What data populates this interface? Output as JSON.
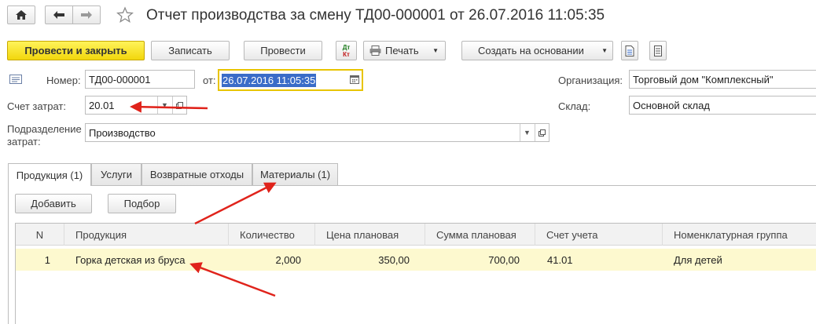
{
  "window": {
    "title": "Отчет производства за смену ТД00-000001 от 26.07.2016 11:05:35"
  },
  "nav": {
    "home_icon": "home-icon",
    "back_icon": "arrow-left-icon",
    "forward_icon": "arrow-right-icon",
    "favorite_icon": "star-icon"
  },
  "toolbar": {
    "post_close": "Провести и закрыть",
    "save": "Записать",
    "post": "Провести",
    "dtkt_top": "Дт",
    "dtkt_bottom": "Кт",
    "print": "Печать",
    "create_based": "Создать на основании"
  },
  "form": {
    "number_label": "Номер:",
    "number_value": "ТД00-000001",
    "date_label": "от:",
    "date_value": "26.07.2016 11:05:35",
    "org_label": "Организация:",
    "org_value": "Торговый дом \"Комплексный\"",
    "cost_account_label": "Счет затрат:",
    "cost_account_value": "20.01",
    "warehouse_label": "Склад:",
    "warehouse_value": "Основной склад",
    "division_label_1": "Подразделение",
    "division_label_2": "затрат:",
    "division_value": "Производство"
  },
  "tabs": [
    {
      "label": "Продукция (1)",
      "active": true
    },
    {
      "label": "Услуги",
      "active": false
    },
    {
      "label": "Возвратные отходы",
      "active": false
    },
    {
      "label": "Материалы (1)",
      "active": false
    }
  ],
  "table_toolbar": {
    "add": "Добавить",
    "select": "Подбор"
  },
  "table": {
    "columns": [
      "N",
      "Продукция",
      "Количество",
      "Цена плановая",
      "Сумма плановая",
      "Счет учета",
      "Номенклатурная группа"
    ],
    "rows": [
      [
        "1",
        "Горка детская из бруса",
        "2,000",
        "350,00",
        "700,00",
        "41.01",
        "Для детей"
      ]
    ]
  },
  "colors": {
    "primary_button": "#f2d70c",
    "focus_border": "#e8c400",
    "selected_row": "#fdf9cf",
    "date_selection": "#3a6cc8",
    "annotation_arrow": "#e0231b"
  }
}
